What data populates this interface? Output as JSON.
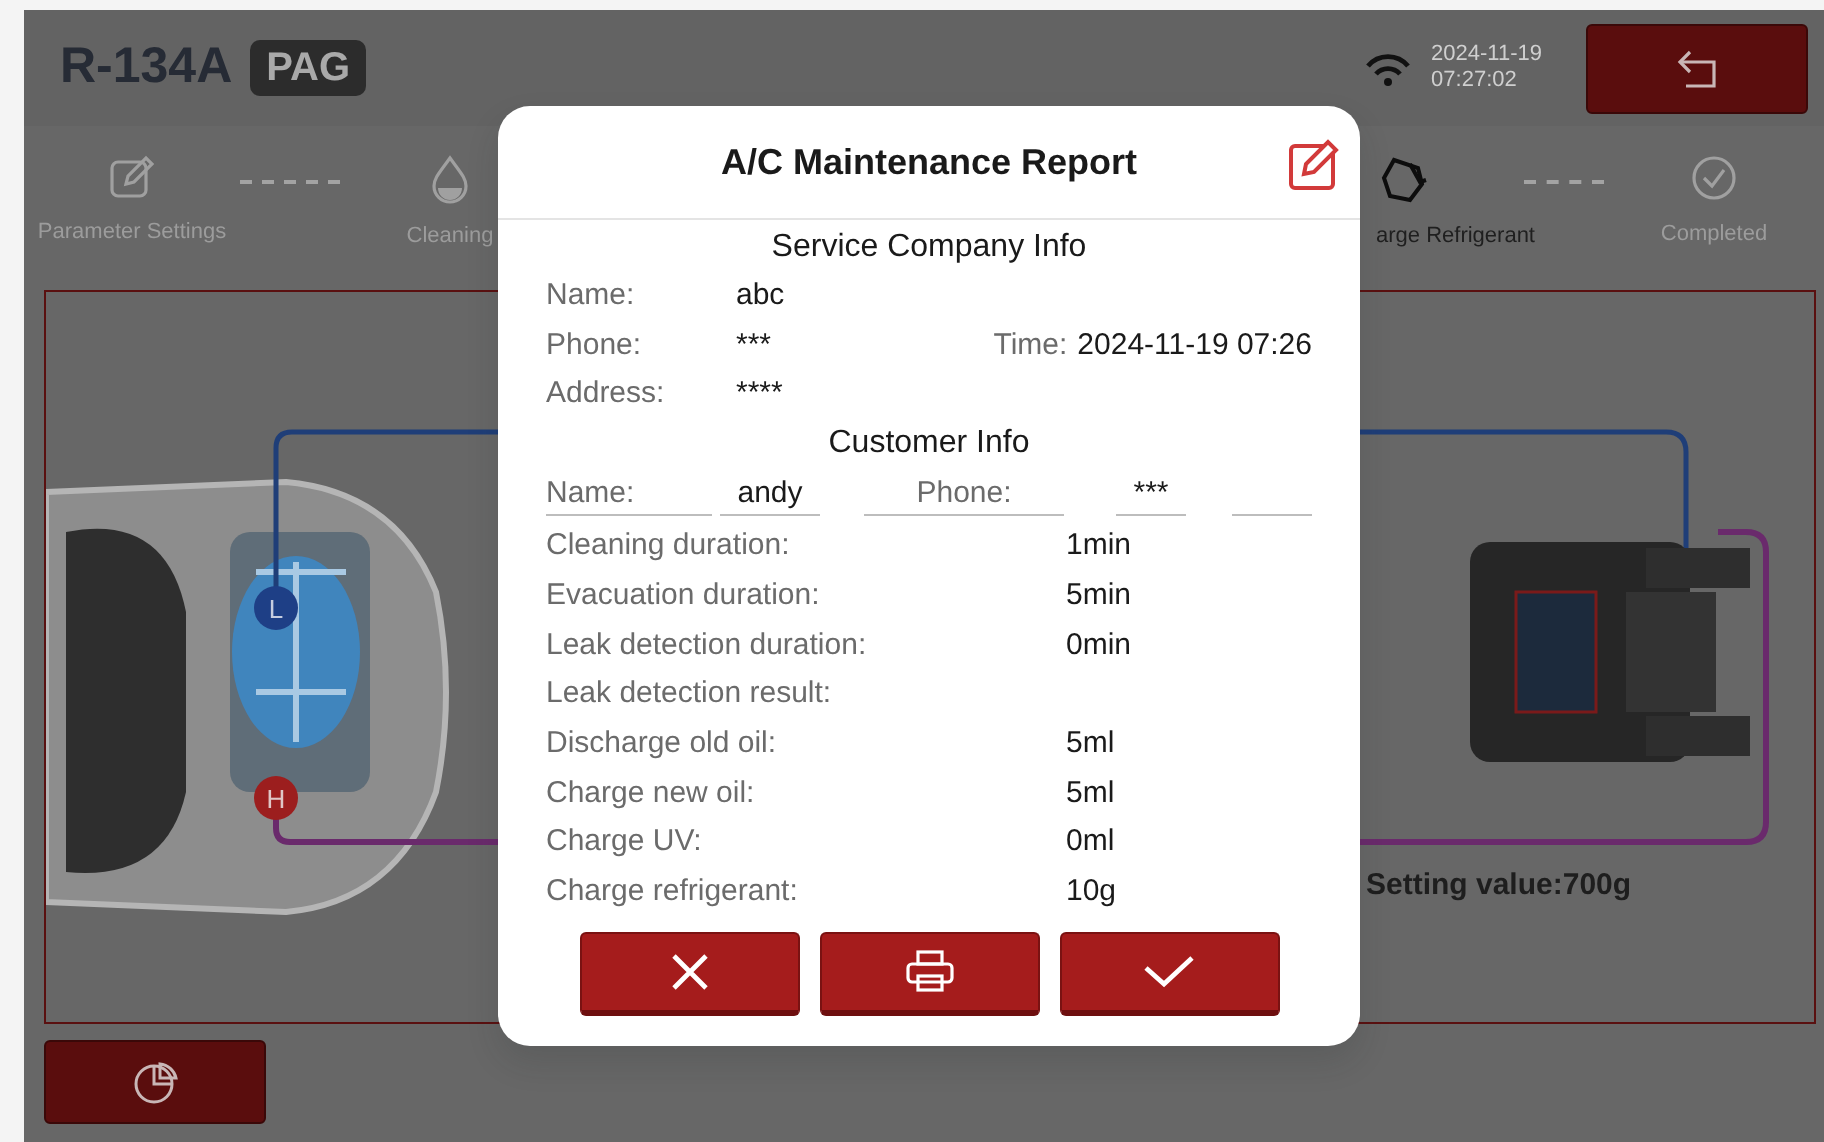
{
  "header": {
    "refrigerant": "R-134A",
    "oil_type": "PAG",
    "date": "2024-11-19",
    "clock": "07:27:02"
  },
  "steps": [
    {
      "label": "Parameter Settings",
      "current": false
    },
    {
      "label": "Cleaning",
      "current": false
    },
    {
      "label": "arge Refrigerant",
      "current": true
    },
    {
      "label": "Completed",
      "current": false
    }
  ],
  "diagram": {
    "low_marker": "L",
    "high_marker": "H",
    "setting_value": "Setting value:700g"
  },
  "report": {
    "title": "A/C Maintenance Report",
    "company_heading": "Service Company Info",
    "company": [
      {
        "label": "Name:",
        "value": "abc"
      },
      {
        "label": "Phone:",
        "value": "***",
        "time_label": "Time:",
        "time_value": "2024-11-19 07:26"
      },
      {
        "label": "Address:",
        "value": "****"
      }
    ],
    "customer_heading": "Customer Info",
    "customer": [
      {
        "label": "Name:",
        "value": "andy"
      },
      {
        "label": "Phone:",
        "value": "***"
      }
    ],
    "details": [
      {
        "label": "Cleaning duration:",
        "value": "1min"
      },
      {
        "label": "Evacuation duration:",
        "value": "5min"
      },
      {
        "label": "Leak detection duration:",
        "value": "0min"
      },
      {
        "label": "Leak detection result:"
      },
      {
        "label": "Discharge old oil:",
        "value": "5ml"
      },
      {
        "label": "Charge new oil:",
        "value": "5ml"
      },
      {
        "label": "Charge UV:",
        "value": "0ml"
      },
      {
        "label": "Charge refrigerant:",
        "value": "10g"
      }
    ]
  }
}
